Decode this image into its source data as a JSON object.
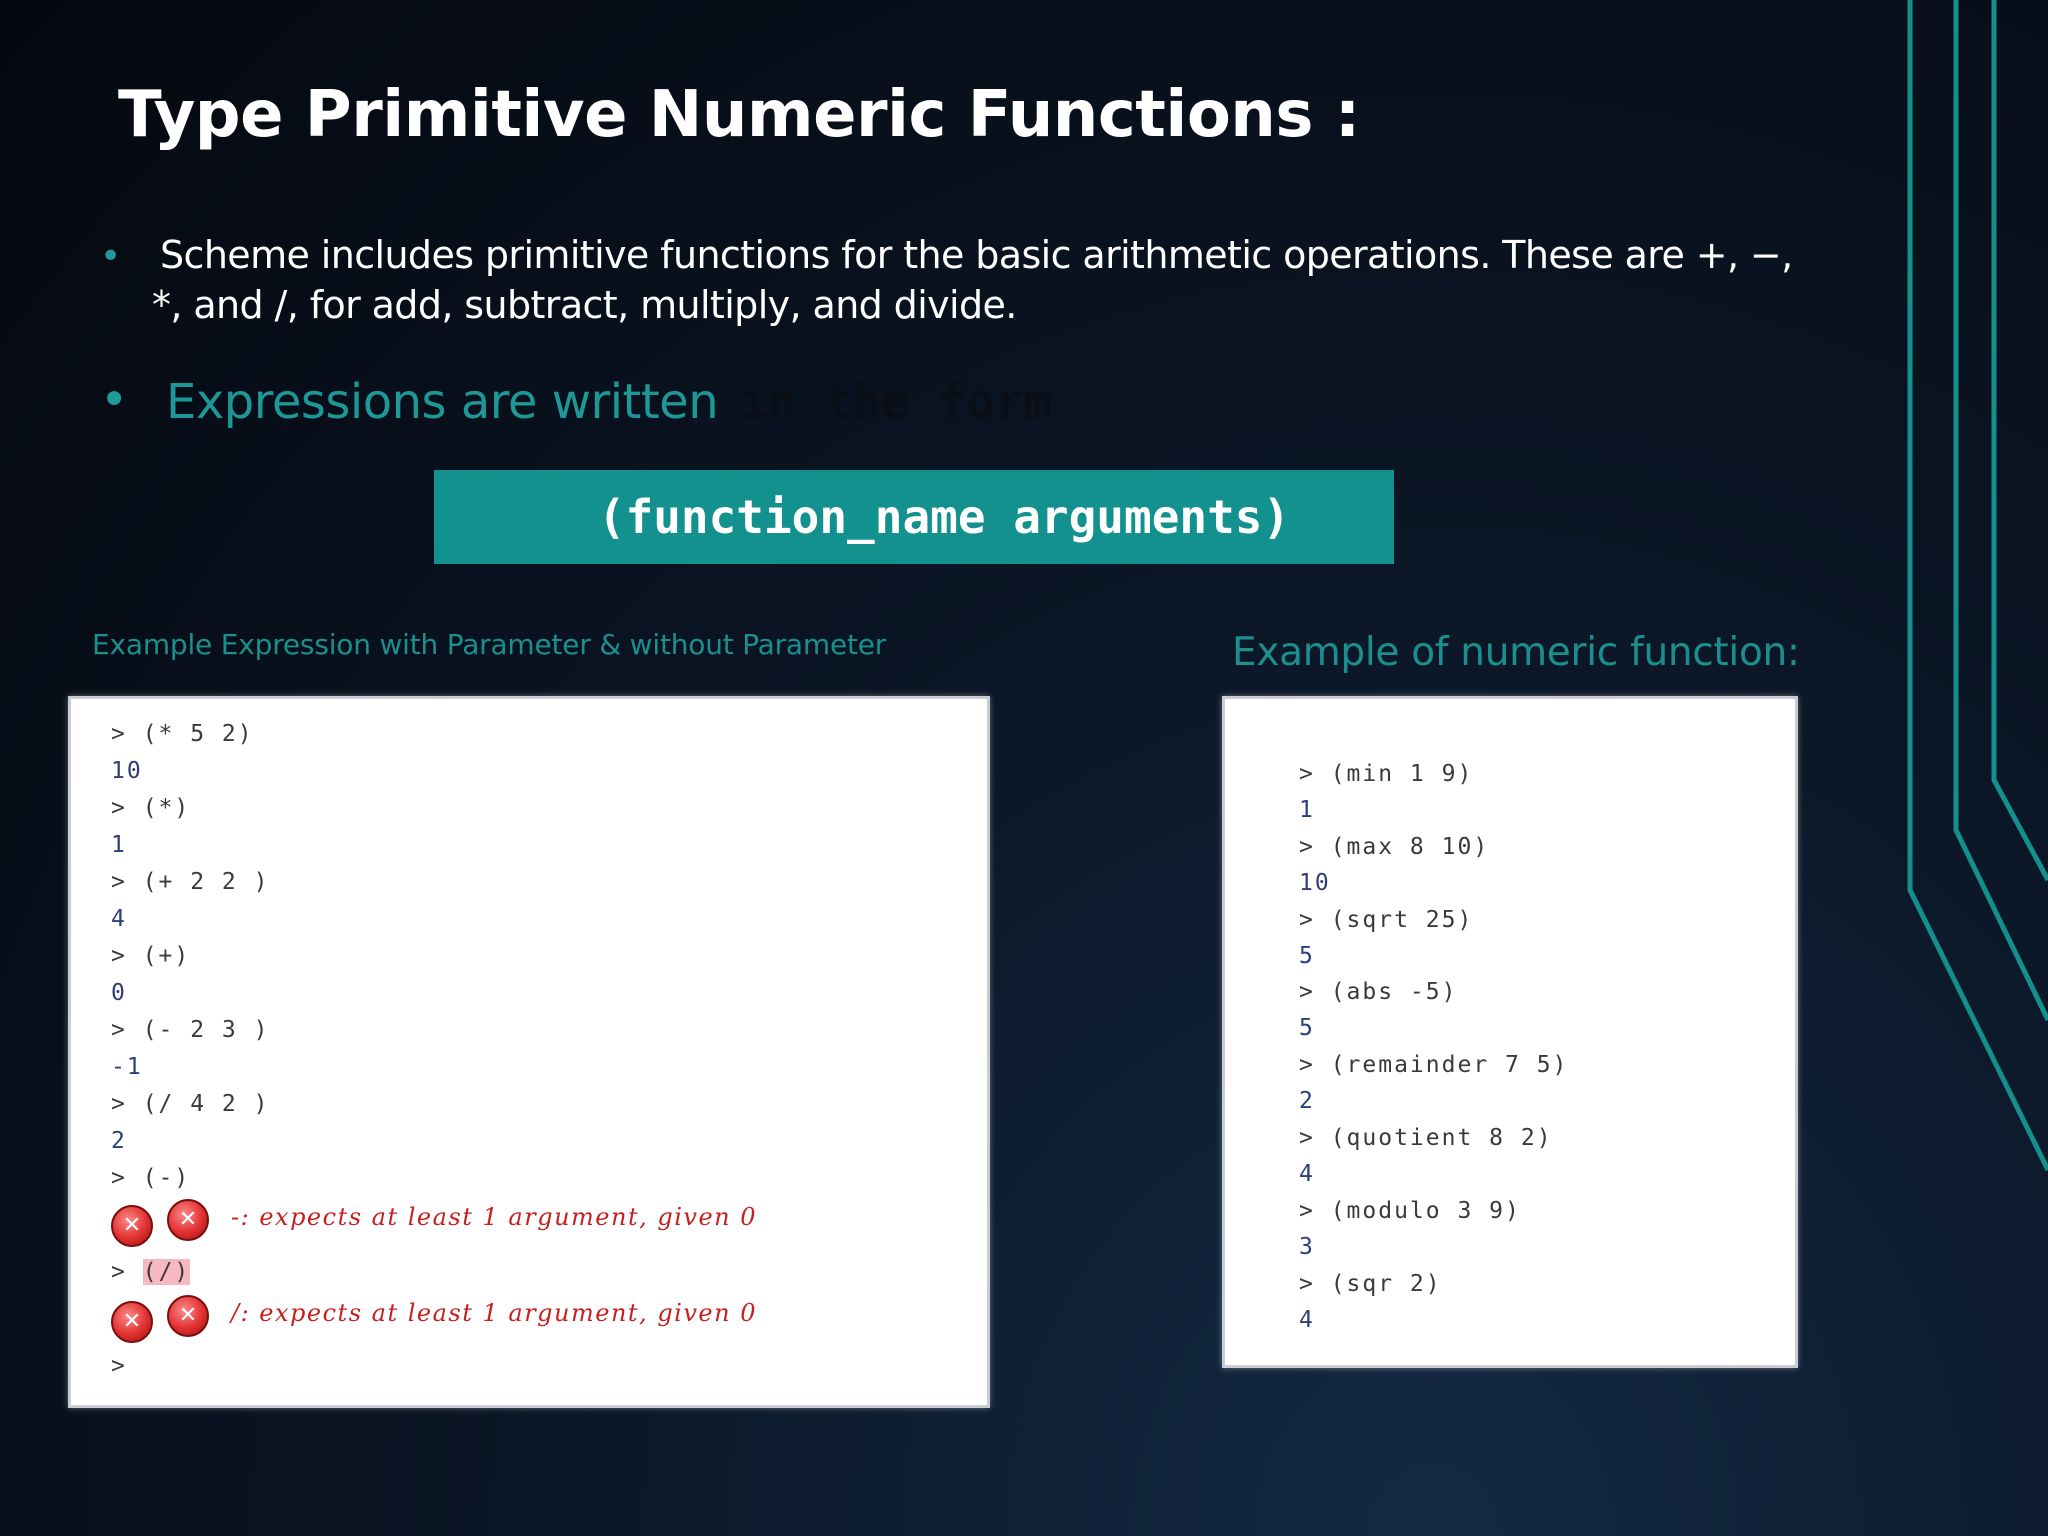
{
  "slide": {
    "title": "Type Primitive Numeric Functions :",
    "bullets": [
      {
        "line1": "Scheme includes primitive functions for the basic arithmetic operations. These are +, −,",
        "line2": "*, and /, for add, subtract, multiply, and divide."
      },
      {
        "text": "Expressions are written",
        "faded_text": "in the form"
      }
    ],
    "syntax": "(function_name arguments)",
    "caption_left": "Example Expression with Parameter & without Parameter",
    "caption_right": "Example of numeric function:",
    "accent_color": "#1d9896"
  },
  "left_panel": {
    "lines": [
      "> (* 5 2)",
      "10",
      "> (*)",
      "1",
      "> (+ 2 2 )",
      "4",
      "> (+)",
      "0",
      "> (- 2 3 )",
      "-1",
      "> (/ 4 2 )",
      "2",
      "> (-)"
    ],
    "error1": "-: expects at least 1 argument, given 0",
    "prompt_after_error1": ">",
    "highlighted_expr": "(/)",
    "error2": "/: expects at least 1 argument, given 0",
    "final_prompt": ">",
    "error_icon": "error-x-icon"
  },
  "right_panel": {
    "lines": [
      "> (min 1 9)",
      "1",
      "> (max 8 10)",
      "10",
      "> (sqrt 25)",
      "5",
      "> (abs -5)",
      "5",
      "> (remainder 7 5)",
      "2",
      "> (quotient 8 2)",
      "4",
      "> (modulo 3 9)",
      "3",
      "> (sqr 2)",
      "4"
    ]
  }
}
